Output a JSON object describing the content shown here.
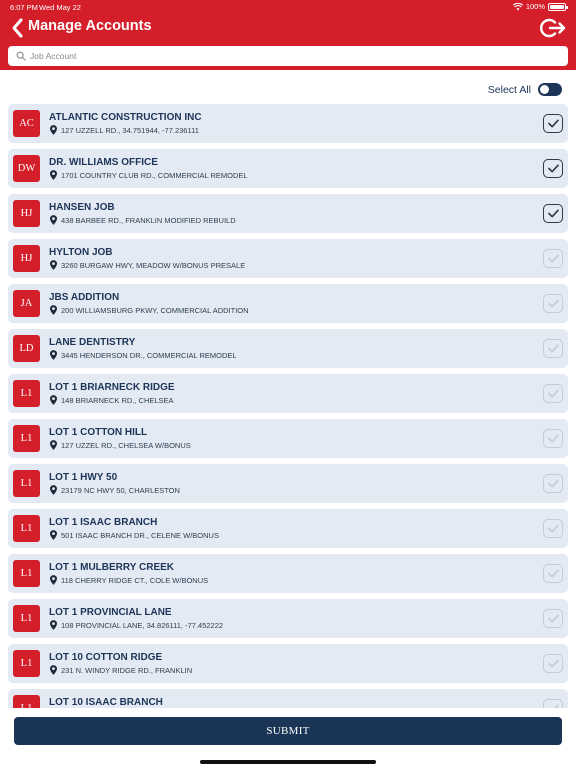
{
  "status_bar": {
    "time": "6:07 PM",
    "date": "Wed May 22",
    "battery": "100%"
  },
  "header": {
    "title": "Manage Accounts",
    "back_icon": "chevron-left-icon",
    "logout_icon": "logout-icon"
  },
  "search": {
    "placeholder": "Job Account",
    "value": ""
  },
  "select_all": {
    "label": "Select All",
    "on": false
  },
  "accounts": [
    {
      "initials": "AC",
      "name": "ATLANTIC CONSTRUCTION INC",
      "address": "127 UZZELL RD., 34.751944, -77.236111",
      "selected": true
    },
    {
      "initials": "DW",
      "name": "DR. WILLIAMS OFFICE",
      "address": "1701 COUNTRY CLUB RD., COMMERCIAL REMODEL",
      "selected": true
    },
    {
      "initials": "HJ",
      "name": "HANSEN JOB",
      "address": "438 BARBEE RD., FRANKLIN MODIFIED REBUILD",
      "selected": true
    },
    {
      "initials": "HJ",
      "name": "HYLTON JOB",
      "address": "3260 BURGAW HWY, MEADOW W/BONUS PRESALE",
      "selected": false
    },
    {
      "initials": "JA",
      "name": "JBS ADDITION",
      "address": "200 WILLIAMSBURG PKWY, COMMERCIAL ADDITION",
      "selected": false
    },
    {
      "initials": "LD",
      "name": "LANE DENTISTRY",
      "address": "3445 HENDERSON DR., COMMERCIAL REMODEL",
      "selected": false
    },
    {
      "initials": "L1",
      "name": "LOT 1 BRIARNECK RIDGE",
      "address": "148 BRIARNECK RD., CHELSEA",
      "selected": false
    },
    {
      "initials": "L1",
      "name": "LOT 1 COTTON HILL",
      "address": "127 UZZEL RD., CHELSEA W/BONUS",
      "selected": false
    },
    {
      "initials": "L1",
      "name": "LOT 1 HWY 50",
      "address": "23179 NC HWY 50, CHARLESTON",
      "selected": false
    },
    {
      "initials": "L1",
      "name": "LOT 1 ISAAC BRANCH",
      "address": "501 ISAAC BRANCH DR., CELENE W/BONUS",
      "selected": false
    },
    {
      "initials": "L1",
      "name": "LOT 1 MULBERRY CREEK",
      "address": "118 CHERRY RIDGE CT., COLE W/BONUS",
      "selected": false
    },
    {
      "initials": "L1",
      "name": "LOT 1 PROVINCIAL LANE",
      "address": "108 PROVINCIAL LANE, 34.826111, -77.452222",
      "selected": false
    },
    {
      "initials": "L1",
      "name": "LOT 10 COTTON RIDGE",
      "address": "231 N. WINDY RIDGE RD., FRANKLIN",
      "selected": false
    },
    {
      "initials": "L1",
      "name": "LOT 10 ISAAC BRANCH",
      "address": "",
      "selected": false
    }
  ],
  "submit": {
    "label": "SUBMIT"
  },
  "colors": {
    "brand_red": "#d41f2b",
    "navy": "#1a3556",
    "card_bg": "#e4eaf4"
  }
}
